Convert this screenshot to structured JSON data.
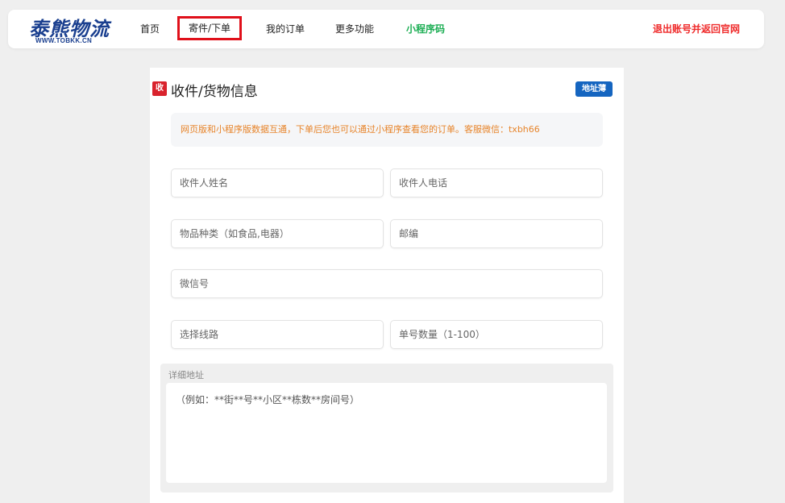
{
  "header": {
    "logo_text": "泰熊物流",
    "logo_sub": "WWW.TOBKK.CN",
    "nav": {
      "home": "首页",
      "send_order": "寄件/下单",
      "my_orders": "我的订单",
      "more": "更多功能",
      "mini_code": "小程序码"
    },
    "logout": "退出账号并返回官网"
  },
  "form": {
    "section_badge": "收",
    "section_title": "收件/货物信息",
    "address_book_button": "地址薄",
    "notice": "网页版和小程序版数据互通，下单后您也可以通过小程序查看您的订单。客服微信：txbh66",
    "fields": {
      "recipient_name": {
        "placeholder": "收件人姓名",
        "value": ""
      },
      "recipient_phone": {
        "placeholder": "收件人电话",
        "value": ""
      },
      "item_type": {
        "placeholder": "物品种类（如食品,电器）",
        "value": ""
      },
      "zipcode": {
        "placeholder": "邮编",
        "value": ""
      },
      "wechat": {
        "placeholder": "微信号",
        "value": ""
      },
      "route": {
        "placeholder": "选择线路",
        "value": ""
      },
      "order_count": {
        "placeholder": "单号数量（1-100）",
        "value": ""
      }
    },
    "detail_address": {
      "label": "详细地址",
      "placeholder": "（例如：**街**号**小区**栋数**房间号）",
      "value": ""
    }
  },
  "colors": {
    "brand_blue": "#1a3f8f",
    "active_border": "#e0101a",
    "mini_code_green": "#1cae54",
    "logout_red": "#ef2b2b",
    "badge_red": "#d9232d",
    "address_book_blue": "#1565c0",
    "notice_orange": "#e7842a"
  }
}
